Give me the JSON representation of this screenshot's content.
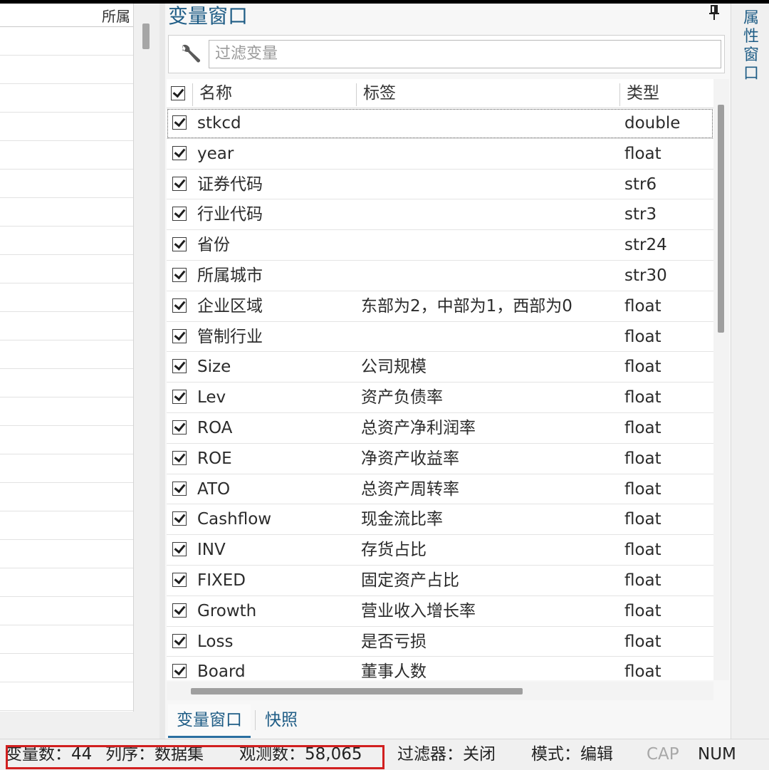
{
  "left_grid": {
    "header_label": "所属"
  },
  "var_window": {
    "title": "变量窗口",
    "filter": {
      "placeholder": "过滤变量",
      "value": ""
    },
    "columns": {
      "name": "名称",
      "label": "标签",
      "type": "类型"
    },
    "rows": [
      {
        "name": "stkcd",
        "label": "",
        "type": "double",
        "checked": true
      },
      {
        "name": "year",
        "label": "",
        "type": "float",
        "checked": true
      },
      {
        "name": "证券代码",
        "label": "",
        "type": "str6",
        "checked": true
      },
      {
        "name": "行业代码",
        "label": "",
        "type": "str3",
        "checked": true
      },
      {
        "name": "省份",
        "label": "",
        "type": "str24",
        "checked": true
      },
      {
        "name": "所属城市",
        "label": "",
        "type": "str30",
        "checked": true
      },
      {
        "name": "企业区域",
        "label": "东部为2，中部为1，西部为0",
        "type": "float",
        "checked": true
      },
      {
        "name": "管制行业",
        "label": "",
        "type": "float",
        "checked": true
      },
      {
        "name": "Size",
        "label": "公司规模",
        "type": "float",
        "checked": true
      },
      {
        "name": "Lev",
        "label": "资产负债率",
        "type": "float",
        "checked": true
      },
      {
        "name": "ROA",
        "label": "总资产净利润率",
        "type": "float",
        "checked": true
      },
      {
        "name": "ROE",
        "label": "净资产收益率",
        "type": "float",
        "checked": true
      },
      {
        "name": "ATO",
        "label": "总资产周转率",
        "type": "float",
        "checked": true
      },
      {
        "name": "Cashflow",
        "label": "现金流比率",
        "type": "float",
        "checked": true
      },
      {
        "name": "INV",
        "label": "存货占比",
        "type": "float",
        "checked": true
      },
      {
        "name": "FIXED",
        "label": "固定资产占比",
        "type": "float",
        "checked": true
      },
      {
        "name": "Growth",
        "label": "营业收入增长率",
        "type": "float",
        "checked": true
      },
      {
        "name": "Loss",
        "label": "是否亏损",
        "type": "float",
        "checked": true
      },
      {
        "name": "Board",
        "label": "董事人数",
        "type": "float",
        "checked": true
      }
    ],
    "tabs": [
      "变量窗口",
      "快照"
    ],
    "icons": [
      "pin-icon",
      "wrench-icon"
    ]
  },
  "right_tab": {
    "label": "属性窗口"
  },
  "statusbar": {
    "var_count": "变量数：44",
    "col_order": "列序：数据集",
    "obs_count": "观测数：58,065",
    "filter": "过滤器：关闭",
    "mode": "模式：编辑",
    "cap": "CAP",
    "num": "NUM"
  },
  "colors": {
    "accent": "#1f5d86",
    "highlight_box": "#d11f1f"
  }
}
